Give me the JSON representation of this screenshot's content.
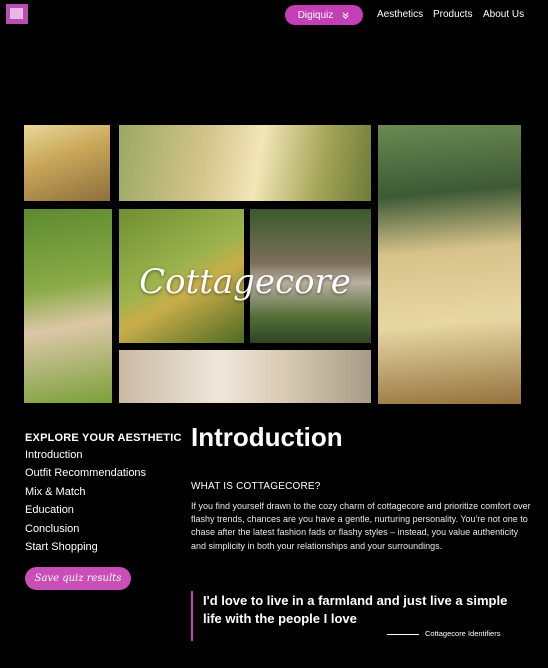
{
  "nav": {
    "quiz_button": "Digiquiz",
    "links": [
      "Aesthetics",
      "Products",
      "About Us"
    ]
  },
  "hero": {
    "title": "Cottagecore"
  },
  "sidebar": {
    "heading": "EXPLORE YOUR AESTHETIC",
    "items": [
      "Introduction",
      "Outfit Recommendations",
      "Mix & Match",
      "Education",
      "Conclusion",
      "Start Shopping"
    ],
    "save_button": "Save quiz results"
  },
  "main": {
    "title": "Introduction",
    "subheading": "WHAT IS COTTAGECORE?",
    "body": "If you find yourself drawn to the cozy charm of cottagecore and prioritize comfort over flashy trends, chances are you have a gentle, nurturing personality. You're not one to chase after the latest fashion fads or flashy styles – instead, you value authenticity and simplicity in both your relationships and your surroundings.",
    "quote": "I'd love to live in a farmland and just live a simple life with the people I love",
    "quote_source": "Cottagecore Identifiers"
  },
  "colors": {
    "accent": "#c43fb6",
    "background": "#000000"
  }
}
